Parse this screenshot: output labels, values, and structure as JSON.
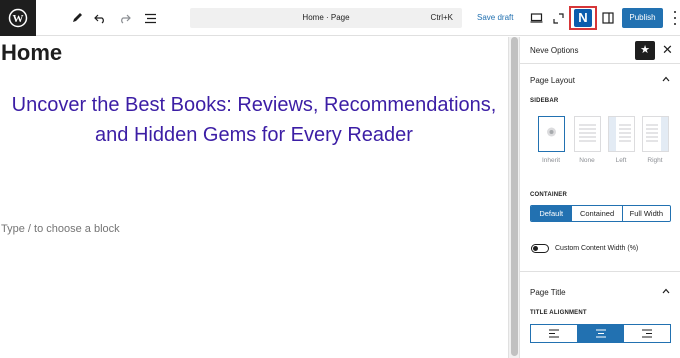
{
  "toolbar": {
    "page_title": "Home · Page",
    "shortcut": "Ctrl+K",
    "save_draft": "Save draft",
    "publish": "Publish",
    "icons": [
      "wordpress-logo",
      "plus-icon",
      "pencil-icon",
      "undo-icon",
      "redo-icon",
      "list-view-icon",
      "desktop-icon",
      "fullscreen-icon",
      "neve-icon",
      "sidebar-toggle-icon",
      "kebab-icon"
    ],
    "accent_color": "#2271b1"
  },
  "canvas": {
    "title": "Home",
    "heading": "Uncover the Best Books: Reviews, Recommendations, and Hidden Gems for Every Reader",
    "heading_color": "#3c1ea5",
    "placeholder": "Type / to choose a block"
  },
  "sidebar": {
    "title": "Neve Options",
    "page_layout": {
      "title": "Page Layout",
      "sidebar_label": "SIDEBAR",
      "options": [
        "Inherit",
        "None",
        "Left",
        "Right"
      ],
      "selected": "Inherit",
      "container_label": "CONTAINER",
      "container_options": [
        "Default",
        "Contained",
        "Full Width"
      ],
      "container_selected": "Default",
      "custom_width_label": "Custom Content Width (%)"
    },
    "page_title": {
      "title": "Page Title",
      "alignment_label": "TITLE ALIGNMENT",
      "alignment_options": [
        "left",
        "center",
        "right"
      ],
      "alignment_selected": "center"
    }
  }
}
